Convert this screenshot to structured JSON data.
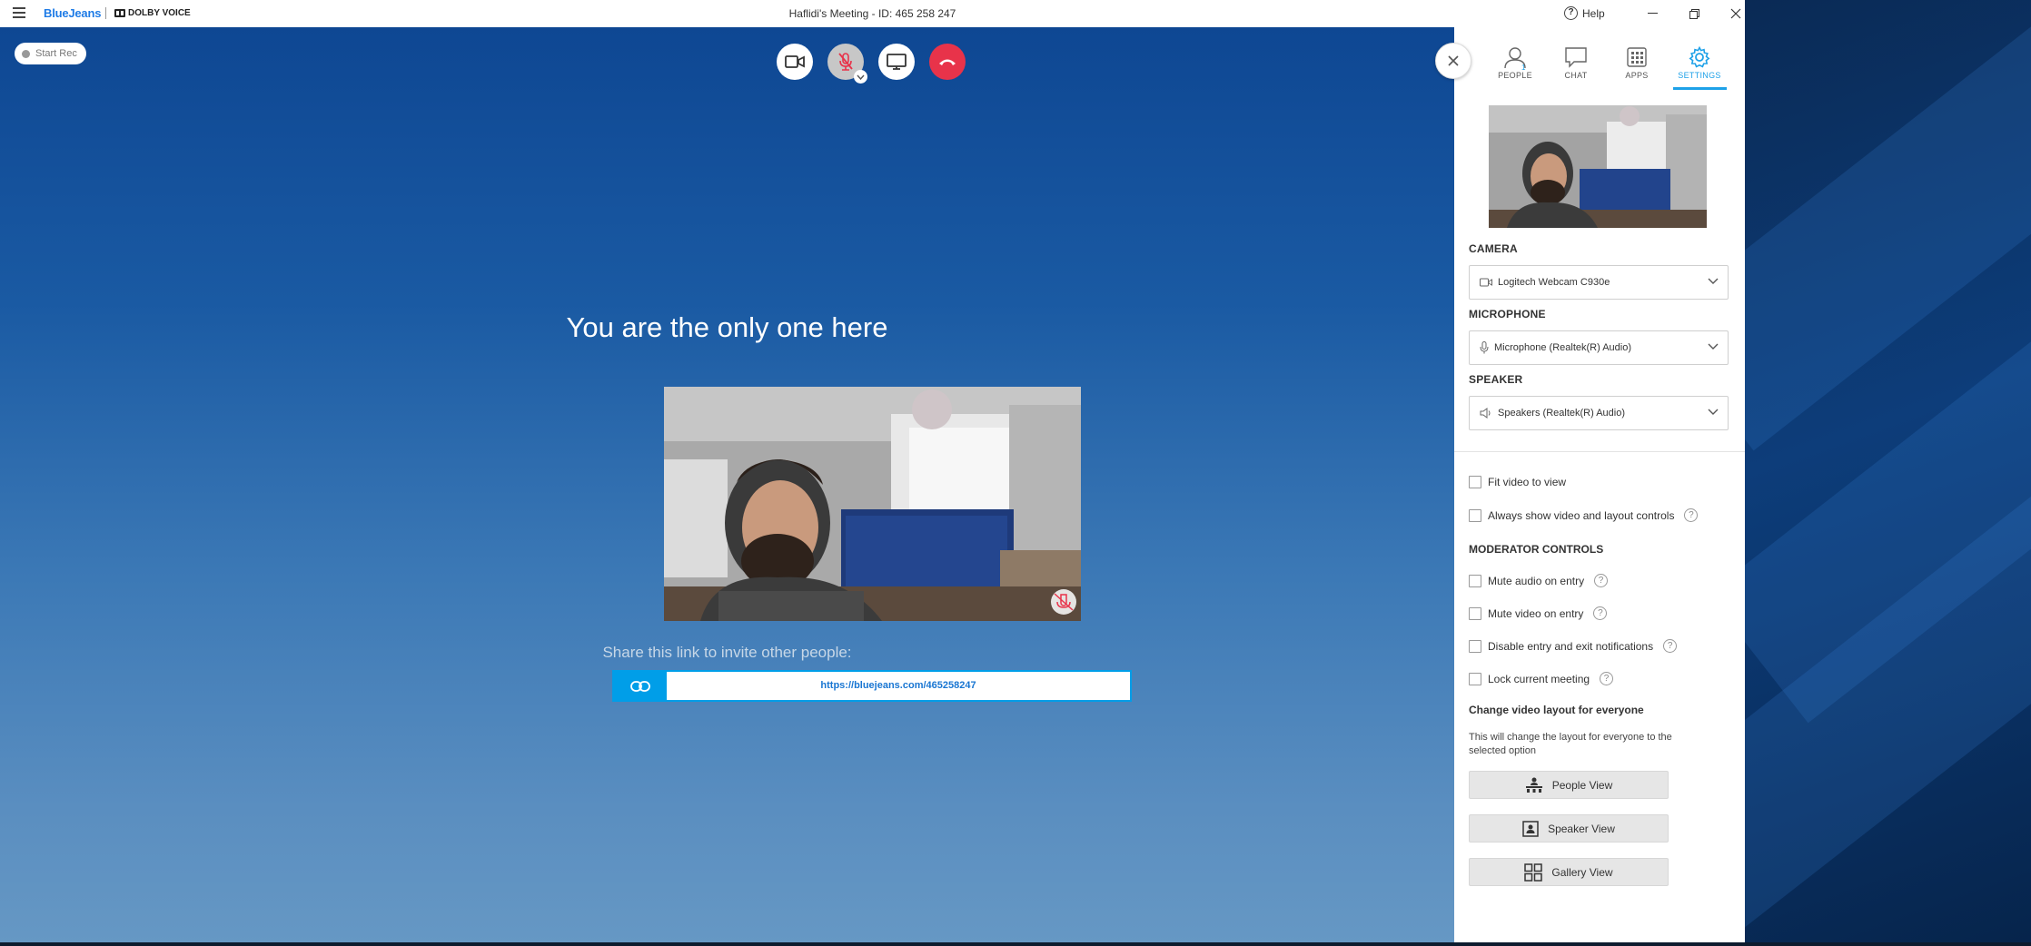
{
  "window": {
    "brand": "BlueJeans",
    "partner": "DOLBY VOICE",
    "title": "Haflidi's Meeting - ID: 465 258 247",
    "help_label": "Help"
  },
  "stage": {
    "start_rec_label": "Start Rec",
    "empty_message": "You are the only one here",
    "share_prompt": "Share this link to invite other people:",
    "share_url": "https://bluejeans.com/465258247"
  },
  "panel": {
    "tabs": [
      {
        "label": "PEOPLE",
        "icon": "person-icon"
      },
      {
        "label": "CHAT",
        "icon": "chat-icon"
      },
      {
        "label": "APPS",
        "icon": "grid-icon"
      },
      {
        "label": "SETTINGS",
        "icon": "gear-icon"
      }
    ],
    "people_count": "1",
    "active_tab": "SETTINGS",
    "camera": {
      "label": "CAMERA",
      "value": "Logitech Webcam C930e"
    },
    "microphone": {
      "label": "MICROPHONE",
      "value": "Microphone (Realtek(R) Audio)"
    },
    "speaker": {
      "label": "SPEAKER",
      "value": "Speakers (Realtek(R) Audio)"
    },
    "options": {
      "fit_video": "Fit video to view",
      "always_show": "Always show video and layout controls"
    },
    "moderator": {
      "heading": "MODERATOR CONTROLS",
      "mute_audio": "Mute audio on entry",
      "mute_video": "Mute video on entry",
      "disable_notifications": "Disable entry and exit notifications",
      "lock_meeting": "Lock current meeting"
    },
    "layout": {
      "heading": "Change video layout for everyone",
      "description": "This will change the layout for everyone to the selected option",
      "people_view": "People View",
      "speaker_view": "Speaker View",
      "gallery_view": "Gallery View"
    }
  },
  "colors": {
    "accent": "#1ea1e8",
    "end_call": "#e8334a",
    "stage_top": "#0e4793",
    "stage_bottom": "#6698c4"
  }
}
